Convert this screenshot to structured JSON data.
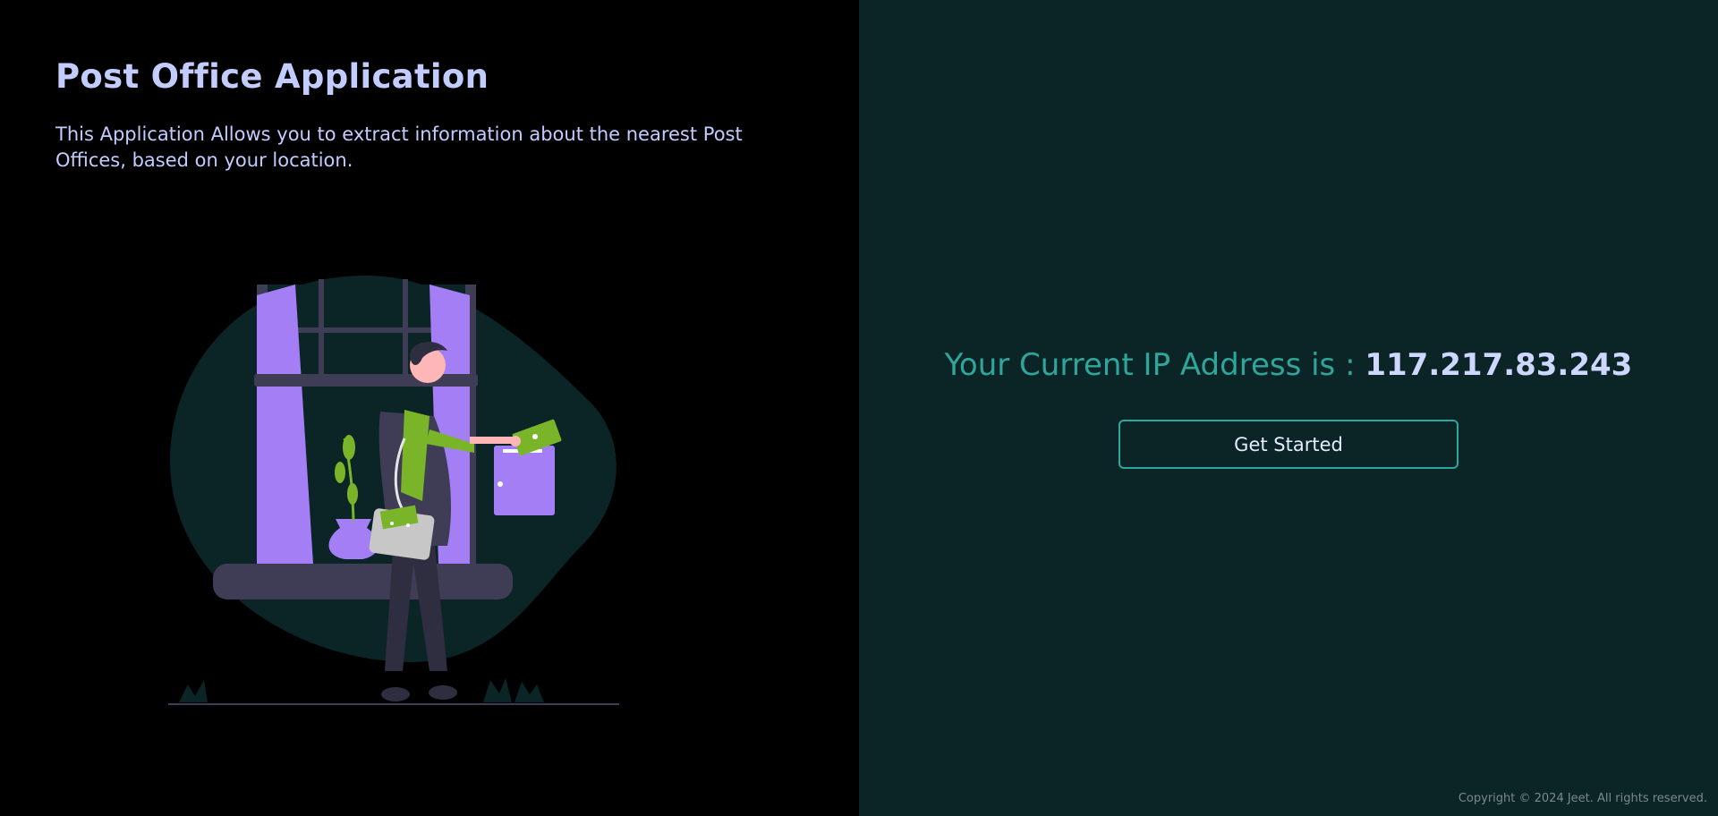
{
  "hero": {
    "title": "Post Office Application",
    "description": "This Application Allows you to extract information about the nearest Post Offices, based on your location."
  },
  "ip": {
    "label": "Your Current IP Address is : ",
    "value": "117.217.83.243"
  },
  "actions": {
    "get_started_label": "Get Started"
  },
  "footer": {
    "copyright": "Copyright © 2024 Jeet. All rights reserved."
  },
  "illustration": {
    "icon": "person-mailing-letter-illustration"
  },
  "colors": {
    "left_bg": "#000000",
    "right_bg": "#0b2426",
    "title": "#c3ccff",
    "accent": "#2fa69c",
    "purple": "#a47ef5",
    "green": "#7ab428"
  }
}
